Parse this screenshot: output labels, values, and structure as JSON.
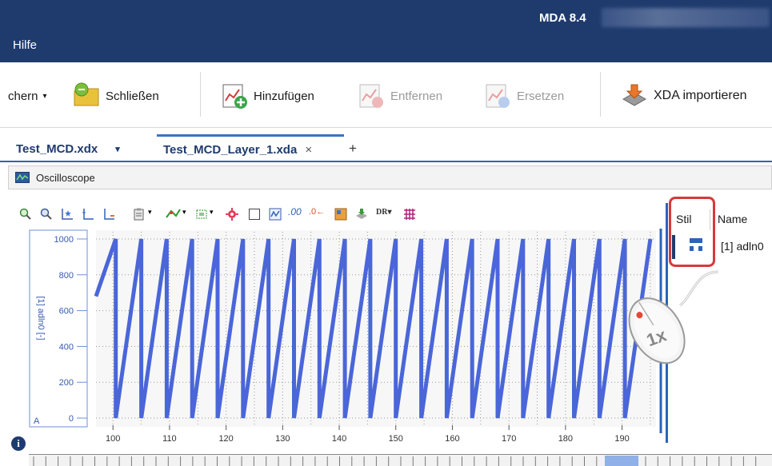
{
  "window": {
    "app_title": "MDA 8.4",
    "menu": {
      "hilfe": "Hilfe"
    }
  },
  "ribbon": {
    "partial_label": "chern",
    "close_label": "Schließen",
    "add_label": "Hinzufügen",
    "remove_label": "Entfernen",
    "replace_label": "Ersetzen",
    "import_label": "XDA importieren"
  },
  "doc_tabs": {
    "tab1": "Test_MCD.xdx",
    "tab2": "Test_MCD_Layer_1.xda",
    "close_glyph": "×",
    "add_glyph": "+",
    "dropdown_glyph": "▾"
  },
  "pane": {
    "title": "Oscilloscope"
  },
  "toolbar": {
    "dr_label": "DR▾"
  },
  "legend": {
    "col_stil": "Stil",
    "col_name": "Name",
    "row1_name": "[1] adln0",
    "mouse_label": "1x",
    "accent": "#2d63b8",
    "highlight": "#d63a3a"
  },
  "chart_data": {
    "type": "line",
    "ylabel": "[1] adln0 [-]",
    "y_ticks": [
      "1000",
      "800",
      "600",
      "400",
      "200",
      "0"
    ],
    "x_ticks": [
      "100",
      "110",
      "120",
      "130",
      "140",
      "150",
      "160",
      "170",
      "180",
      "190"
    ],
    "xlim": [
      97,
      196
    ],
    "ylim": [
      -40,
      1040
    ],
    "corner_label": "A",
    "line_color": "#4a66d8",
    "series": [
      {
        "x": [
          97,
          100.5,
          100.5,
          105,
          105,
          109.5,
          109.5,
          114,
          114,
          118.5,
          118.5,
          123,
          123,
          127.5,
          127.5,
          132,
          132,
          136.5,
          136.5,
          141,
          141,
          145.5,
          145.5,
          150,
          150,
          154.5,
          154.5,
          159,
          159,
          163.5,
          163.5,
          168,
          168,
          172.5,
          172.5,
          177,
          177,
          181.5,
          181.5,
          186,
          186,
          190.5,
          190.5,
          195
        ],
        "y": [
          680,
          1000,
          0,
          1000,
          0,
          1000,
          0,
          1000,
          0,
          1000,
          0,
          1000,
          0,
          1000,
          0,
          1000,
          0,
          1000,
          0,
          1000,
          0,
          1000,
          0,
          1000,
          0,
          1000,
          0,
          1000,
          0,
          1000,
          0,
          1000,
          0,
          1000,
          0,
          1000,
          0,
          1000,
          0,
          1000,
          0,
          1000,
          0,
          1000
        ]
      }
    ],
    "grid": true
  }
}
